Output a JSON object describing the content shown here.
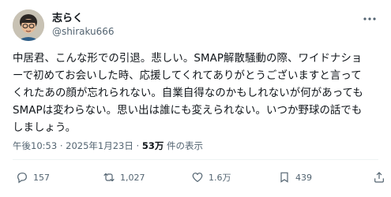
{
  "author": {
    "display_name": "志らく",
    "handle": "@shiraku666"
  },
  "tweet": {
    "lines": [
      "中居君、こんな形での引退。悲しい。SMAP解散騒動の際、ワイドナショ",
      "ーで初めてお会いした時、応援してくれてありがとうございますと言って",
      "くれたあの顔が忘れられない。自業自得なのかもしれないが何があっても",
      "SMAPは変わらない。思い出は誰にも変えられない。いつか野球の話でも",
      "しましょう。"
    ]
  },
  "meta": {
    "time": "午後10:53",
    "separator": "·",
    "date": "2025年1月23日",
    "views_count": "53万",
    "views_label": "件の表示"
  },
  "actions": {
    "reply_count": "157",
    "retweet_count": "1,027",
    "like_count": "1.6万",
    "view_count": "439"
  },
  "colors": {
    "text": "#0f1419",
    "secondary": "#536471",
    "divider": "#eff3f4"
  },
  "icons": [
    "more-icon",
    "reply-icon",
    "retweet-icon",
    "like-icon",
    "bookmark-icon",
    "share-icon"
  ]
}
